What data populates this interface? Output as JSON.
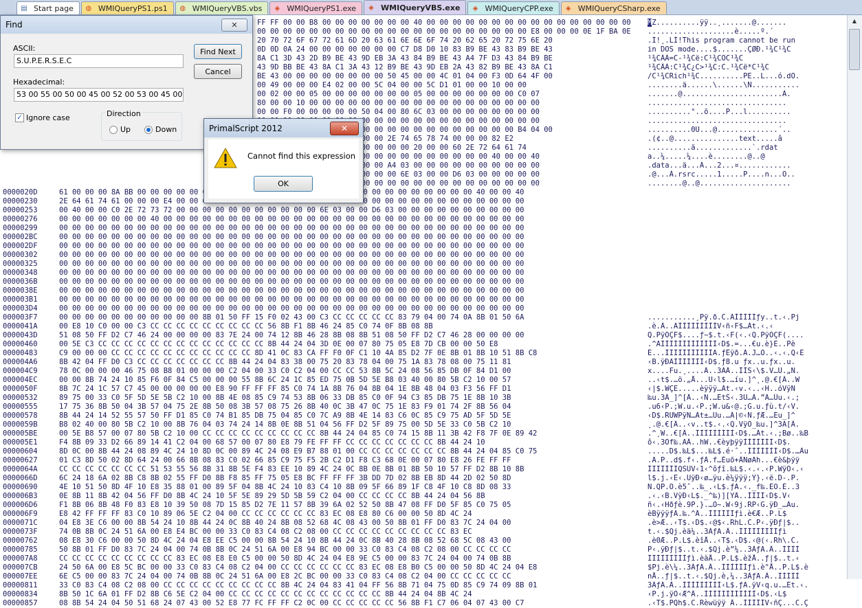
{
  "tabs": [
    {
      "label": "Start page",
      "color": "#ffffff",
      "icon": "page-icon"
    },
    {
      "label": "WMIQueryPS1.ps1",
      "color": "#f7e08a",
      "icon": "script-icon"
    },
    {
      "label": "WMIQueryVBS.vbs",
      "color": "#dff0c6",
      "icon": "script-icon"
    },
    {
      "label": "WMIQueryPS1.exe",
      "color": "#f5c6d6",
      "icon": "exe-icon"
    },
    {
      "label": "WMIQueryVBS.exe",
      "color": "#d8d2ee",
      "icon": "exe-icon",
      "active": true
    },
    {
      "label": "WMIQueryCPP.exe",
      "color": "#c9ecec",
      "icon": "exe-icon"
    },
    {
      "label": "WMIQueryCSharp.exe",
      "color": "#f8d7a6",
      "icon": "exe-icon"
    }
  ],
  "hex_rows_top": [
    {
      "bytes": "FF FF 00 00 B8 00 00 00 00 00 00 00 40 00 00 00 00 00 00 00 00 00 00 00 00 00 00 00 00 00 00 00",
      "ascii": "MZ..........ÿÿ..¸.......@......."
    },
    {
      "bytes": "00 00 00 00 00 00 00 00 00 00 00 00 00 00 00 00 00 00 00 00 00 E8 00 00 00 0E 1F BA 0E 00 B4",
      "ascii": "....................è.....º.´"
    },
    {
      "bytes": "20 70 72 6F 67 72 61 6D 20 63 61 6E 6E 6F 74 20 62 65 20 72 75 6E 20",
      "ascii": ".Í!¸.LÍ!This program cannot be run"
    },
    {
      "bytes": "0D 0D 0A 24 00 00 00 00 00 00 00 C7 D8 D0 10 83 B9 BE 43 83 B9 BE 43",
      "ascii": "in DOS mode....$.......ÇØÐ.¹¾C¹¾C"
    },
    {
      "bytes": "8A C1 3D 43 2D B9 BE 43 9D EB 3A 43 84 B9 BE 43 A4 7F D3 43 84 B9 BE",
      "ascii": "¹¾CÂÁ=C-¹¾Cë:C¹¾CÔC¹¾C"
    },
    {
      "bytes": "43 9D BB BE 43 8A C1 3A 43 12 B9 BE 43 9D EB 2A 43 82 B9 BE 43 8A C1",
      "ascii": "¹¾CÂÁ:C¹¾C¿C>¹¾C:C.¹¾Cë*C¹¾C"
    },
    {
      "bytes": "BE 43 00 00 00 00 00 00 00 00 50 45 00 00 4C 01 04 00 F3 0D 64 4F 00",
      "ascii": "/C¹¾CRich¹¾C..........PE..L...ó.dO."
    },
    {
      "bytes": "00 49 00 00 00 E4 02 00 00 5C 04 00 00 5C D1 01 00 00 10 00 00",
      "ascii": "........ä......\\......\\Ñ..........."
    },
    {
      "bytes": "00 02 00 00 05 00 00 00 00 00 00 00 05 00 00 00 00 00 00 00 C0 07",
      "ascii": ".......@.......................À."
    },
    {
      "bytes": "80 00 00 10 00 00 00 00 00 00 00 00 00 00 00 00 00 00 00 00 00 00",
      "ascii": "................................"
    },
    {
      "bytes": "00 00 F0 00 00 00 00 00 50 04 00 80 6C 03 00 00 00 00 00 00 00 00",
      "ascii": "..........°..õ....P...l.........."
    },
    {
      "bytes": "00 00 00 00 00 00 00 00 00 00 00 00 00 00 00 00 00 00 00 00 00 00",
      "ascii": "................................"
    },
    {
      "bytes": "00 00 00 00 00 00 00 00 00 00 00 00 00 00 00 00 00 00 00 00 B4 04 00",
      "ascii": "..........0U...@..............´.."
    },
    {
      "bytes": "00 00 00 00 00 00 00 00 00 00 2E 74 65 78 74 00 00 00 82 E2",
      "ascii": ".(¢..@...............text.....â"
    },
    {
      "bytes": "00 00 00 00 00 00 00 00 00 00 00 00 20 00 00 60 2E 72 64 61 74",
      "ascii": "..........ä.............`.rdat"
    },
    {
      "bytes": "00 00 00 00 00 00 00 00 00 00 00 00 00 00 00 00 00 00 40 00 00 40",
      "ascii": "a..¼.....¼....è........@..@"
    },
    {
      "bytes": "00 00 00 00 00 00 00 00 00 00 A4 03 00 00 00 00 00 00 00 00 00 00",
      "ascii": ".data...ä...Á...2...¤............"
    },
    {
      "bytes": "00 00 00 00 00 00 00 00 00 00 00 6E 03 00 00 D6 03 00 00 00 00 00",
      "ascii": ".@...Á.rsrc.....1.....P....n...Ö.."
    },
    {
      "bytes": "00 00 00 00 00 00 00 00 00 00 00 00 00 00 00 00 00 00 00 00 00 00",
      "ascii": "........@..@....................."
    }
  ],
  "hex_rows": [
    {
      "addr": "0000020D",
      "bytes": "61 00 00 00 8A BB 00 00 00 00 00 00 00 00 00 00 00 00 00 00 00 00 00 00 00 00 00 00 00 00 00 00 40 00 00 40",
      "ascii": ""
    },
    {
      "addr": "00000230",
      "bytes": "2E 64 61 74 61 00 00 00 E4 00 00 00 00 00 00 00 00 00 00 00 A4 03 00 00 00 00 00 00 00 00 00 00 00 00 00 00",
      "ascii": ""
    },
    {
      "addr": "00000253",
      "bytes": "00 40 00 00 C0 2E 72 73 72 00 00 00 00 00 00 00 00 00 00 00 6E 03 00 00 D6 03 00 00 00 00 00 00 00 00 00 00",
      "ascii": ""
    },
    {
      "addr": "00000276",
      "bytes": "00 00 00 00 00 00 00 40 00 00 00 00 00 00 00 00 00 00 00 00 00 00 00 00 00 00 00 00 00 00 00 00 00 00 00 00",
      "ascii": ""
    },
    {
      "addr": "00000299",
      "bytes": "00 00 00 00 00 00 00 00 00 00 00 00 00 00 00 00 00 00 00 00 00 00 00 00 00 00 00 00 00 00 00 00 00 00 00 00",
      "ascii": ""
    },
    {
      "addr": "000002BC",
      "bytes": "00 00 00 00 00 00 00 00 00 00 00 00 00 00 00 00 00 00 00 00 00 00 00 00 00 00 00 00 00 00 00 00 00 00 00 00",
      "ascii": ""
    },
    {
      "addr": "000002DF",
      "bytes": "00 00 00 00 00 00 00 00 00 00 00 00 00 00 00 00 00 00 00 00 00 00 00 00 00 00 00 00 00 00 00 00 00 00 00 00",
      "ascii": ""
    },
    {
      "addr": "00000302",
      "bytes": "00 00 00 00 00 00 00 00 00 00 00 00 00 00 00 00 00 00 00 00 00 00 00 00 00 00 00 00 00 00 00 00 00 00 00 00",
      "ascii": ""
    },
    {
      "addr": "00000325",
      "bytes": "00 00 00 00 00 00 00 00 00 00 00 00 00 00 00 00 00 00 00 00 00 00 00 00 00 00 00 00 00 00 00 00 00 00 00 00",
      "ascii": ""
    },
    {
      "addr": "00000348",
      "bytes": "00 00 00 00 00 00 00 00 00 00 00 00 00 00 00 00 00 00 00 00 00 00 00 00 00 00 00 00 00 00 00 00 00 00 00 00",
      "ascii": ""
    },
    {
      "addr": "0000036B",
      "bytes": "00 00 00 00 00 00 00 00 00 00 00 00 00 00 00 00 00 00 00 00 00 00 00 00 00 00 00 00 00 00 00 00 00 00 00 00",
      "ascii": ""
    },
    {
      "addr": "0000038E",
      "bytes": "00 00 00 00 00 00 00 00 00 00 00 00 00 00 00 00 00 00 00 00 00 00 00 00 00 00 00 00 00 00 00 00 00 00 00 00",
      "ascii": ""
    },
    {
      "addr": "000003B1",
      "bytes": "00 00 00 00 00 00 00 00 00 00 00 00 00 00 00 00 00 00 00 00 00 00 00 00 00 00 00 00 00 00 00 00 00 00 00 00",
      "ascii": ""
    },
    {
      "addr": "000003D4",
      "bytes": "00 00 00 00 00 00 00 00 00 00 00 00 00 00 00 00 00 00 00 00 00 00 00 00 00 00 00 00 00 00 00 00 00 00 00 00",
      "ascii": ""
    },
    {
      "addr": "000003F7",
      "bytes": "00 00 00 00 00 00 00 00 00 00 00 8B 01 50 FF 15 F0 02 43 00 C3 CC CC CC CC CC 83 79 04 00 74 0A 8B 01 50 6A",
      "ascii": "...........¸Pÿ.ð.C.ÃÌÌÌÌÌƒy..t.‹.Pj"
    },
    {
      "addr": "0000041A",
      "bytes": "00 E8 10 C0 00 00 C3 CC CC CC CC CC CC CC CC CC 56 8B F1 8B 46 24 85 C0 74 0F 8B 08 8B",
      "ascii": ".è.À..ÃÌÌÌÌÌÌÌÌÌV‹ñ‹F$…Àt.‹.‹"
    },
    {
      "addr": "0000043D",
      "bytes": "51 08 50 FF D2 C7 46 24 00 00 00 00 83 7E 24 00 74 12 8B 46 28 8B 08 8B 51 08 50 FF D2 C7 46 28 00 00 00 00",
      "ascii": "Q.PÿÒÇF$....ƒ~$.t.‹F(‹.‹Q.PÿÒÇF(...."
    },
    {
      "addr": "00000460",
      "bytes": "00 5E C3 CC CC CC CC CC CC CC CC CC CC CC CC CC 8B 44 24 04 3D 0E 00 07 80 75 05 E8 7D CB 00 00 50 E8",
      "ascii": ".^ÃÌÌÌÌÌÌÌÌÌÌÌÌÌ‹D$.=...€u.è}Ë..Pè"
    },
    {
      "addr": "00000483",
      "bytes": "C9 00 00 00 CC CC CC CC CC CC CC CC CC CC CC 8D 41 0C 83 CA FF F0 0F C1 10 4A 85 D2 7F 0E 8B 01 8B 10 51 8B C8",
      "ascii": "É...ÌÌÌÌÌÌÌÌÌÌÌA.ƒÊÿð.Á.J…Ò..‹.‹.Q‹È"
    },
    {
      "addr": "000004A6",
      "bytes": "8B 42 04 FF D0 C3 CC CC CC CC CC CC CC 8B 44 24 04 83 38 00 75 20 83 78 04 00 75 1A 83 78 08 00 75 11 81",
      "ascii": "‹B.ÿÐÃÌÌÌÌÌÌÌ‹D$.ƒ8.u ƒx..u.ƒx..u."
    },
    {
      "addr": "000004C9",
      "bytes": "78 0C 00 00 00 46 75 08 B8 01 00 00 00 C2 04 00 33 C0 C2 04 00 CC CC 53 8B 5C 24 08 56 85 DB 0F 84 D1 00",
      "ascii": "x....Fu.¸....Â..3ÀÂ..ÌÌS‹\\$.V…Û.„Ñ."
    },
    {
      "addr": "000004EC",
      "bytes": "00 00 8B 74 24 10 85 F6 0F 84 C5 00 00 00 55 8B 6C 24 1C 85 ED 75 0B 5D 5E B8 03 40 00 80 5B C2 10 00 57",
      "ascii": "..‹t$.…ö.„Å...U‹l$.…íu.]^¸.@.€[Â..W"
    },
    {
      "addr": "0000050F",
      "bytes": "8B 7C 24 1C 57 C7 45 00 00 00 00 00 E8 90 FF FF FF 85 C0 74 1A 8B 76 04 8B 04 1E 8B 48 04 03 F3 56 FF D1",
      "ascii": "‹|$.WÇE.....èÿÿÿ…Àt.‹v.‹..‹H..óVÿÑ"
    },
    {
      "addr": "00000532",
      "bytes": "89 75 00 33 C0 5F 5D 5E 5B C2 10 00 8B 4E 08 85 C9 74 53 8B 06 33 DB 85 C0 0F 94 C3 85 DB 75 1E 8B 10 3B",
      "ascii": "‰u.3À_]^[Â..‹N.…ÉtS‹.3Û…À.”Ã…Ûu.‹.;"
    },
    {
      "addr": "00000555",
      "bytes": "17 75 36 8B 50 04 3B 57 04 75 2E 8B 50 08 3B 57 08 75 26 8B 40 0C 3B 47 0C 75 1E 83 F9 01 74 2F 8B 56 04",
      "ascii": ".u6‹P.;W.u.‹P.;W.u&‹@.;G.u.ƒù.t/‹V."
    },
    {
      "addr": "00000578",
      "bytes": "8B 44 24 14 52 55 57 50 FF D1 85 C0 74 B1 85 DB 75 04 85 C0 7C A9 8B 4E 14 83 C6 0C 85 C9 75 AD 5F 5D 5E",
      "ascii": "‹D$.RUWPÿÑ…Àt±…Ûu.…À|©‹N.ƒÆ.…Éu­_]^"
    },
    {
      "addr": "0000059B",
      "bytes": "B8 02 40 00 80 5B C2 10 00 8B 76 04 03 74 24 14 8B 0E 8B 51 04 56 FF D2 5F 89 75 00 5D 5E 33 C0 5B C2 10",
      "ascii": "¸.@.€[Â..‹v..t$.‹.‹Q.VÿÒ_‰u.]^3À[Â."
    },
    {
      "addr": "000005BE",
      "bytes": "00 5E B8 57 00 07 80 5B C2 10 00 CC CC CC CC CC CC CC CC CC 8B 44 24 04 85 C0 74 15 8B 11 3B 42 F8 7F 0E 89 42",
      "ascii": ".^¸W..€[Â..ÌÌÌÌÌÌÌÌÌ‹D$.…Àt.‹.;Bø..‰B"
    },
    {
      "addr": "000005E1",
      "bytes": "F4 8B 09 33 D2 66 89 14 41 C2 04 00 68 57 00 07 80 E8 79 FE FF FF CC CC CC CC CC CC CC 8B 44 24 10",
      "ascii": "ô‹.3Òf‰.AÂ..hW..€èyþÿÿÌÌÌÌÌÌÌ‹D$."
    },
    {
      "addr": "00000604",
      "bytes": "8D 0C 00 8B 44 24 08 89 4C 24 10 8D 0C 00 89 4C 24 08 E9 B7 88 01 00 CC CC CC CC CC CC CC 8B 44 24 04 85 C0 75",
      "ascii": ".....D$.‰L$...‰L$.é·ˆ..ÌÌÌÌÌÌÌ‹D$.…Àu"
    },
    {
      "addr": "00000627",
      "bytes": "01 C3 8D 50 02 8D 64 24 00 66 8B 08 83 C0 02 66 85 C9 75 F5 2B C2 D1 F8 C3 68 0E 00 07 80 E8 26 FE FF FF",
      "ascii": ".Ã.P..d$.f‹.ƒÀ.f…Éuõ+ÂÑøÃh...€è&þÿÿ"
    },
    {
      "addr": "0000064A",
      "bytes": "CC CC CC CC CC CC CC 51 53 55 56 8B 31 8B 5E F4 83 EE 10 89 4C 24 0C 8B 0E 8B 01 8B 50 10 57 FF D2 8B 10 8B",
      "ascii": "ÌÌÌÌÌÌÌQSUV‹1‹^ôƒî.‰L$.‹.‹.‹P.WÿÒ‹.‹"
    },
    {
      "addr": "0000066D",
      "bytes": "6C 24 18 6A 02 8B C8 8B 02 55 FF D0 8B F8 85 FF 75 05 E8 BC FF FF FF 3B DD 7D 02 8B EB 8D 44 2D 02 50 8D",
      "ascii": "l$.j.‹È‹.UÿÐ‹ø…ÿu.è¼ÿÿÿ;Ý}.‹ë.D-.P."
    },
    {
      "addr": "00000690",
      "bytes": "4E 10 51 50 8D 4F 10 E8 35 88 01 00 89 5F 04 8B 4C 24 10 83 C4 10 8B 09 5F 66 89 1F C8 4F 10 C8 8D 08 33",
      "ascii": "N.QP.O.è5ˆ..‰_.‹L$.ƒÄ.‹._f‰.ÈO.È..3"
    },
    {
      "addr": "000006B3",
      "bytes": "0E 8B 11 8B 42 04 56 FF D0 8B 4C 24 10 5F 5E 89 29 5D 5B 59 C2 04 00 CC CC CC CC 8B 44 24 04 56 8B",
      "ascii": ".‹.‹B.VÿÐ‹L$._^‰)][YÂ..ÌÌÌÌ‹D$.V‹"
    },
    {
      "addr": "000006D6",
      "bytes": "F1 8B 06 8B 48 F0 83 E8 10 39 50 08 7D 15 85 D2 7E 11 57 8B 39 6A 02 52 50 8B 47 08 FF D0 5F 85 C0 75 05",
      "ascii": "ñ‹.‹Hðƒè.9P.}.…Ò~.W‹9j.RP‹G.ÿÐ_…Àu."
    },
    {
      "addr": "000006F9",
      "bytes": "E8 42 FF FF FF 83 C0 10 89 06 5E C2 04 00 CC CC CC CC CC CC 83 EC 08 E8 80 C6 00 00 50 8D 4C 24",
      "ascii": "èBÿÿÿƒÀ.‰.^Â..ÌÌÌÌÌÌƒì.è€Æ..P.L$"
    },
    {
      "addr": "0000071C",
      "bytes": "04 E8 3E C6 00 00 8B 54 24 10 8B 44 24 0C 8B 40 24 8B 08 52 68 4C 08 43 00 50 8B 01 FF D0 83 7C 24 04 00",
      "ascii": ".è>Æ..‹T$.‹D$.‹@$‹.RhL.C.P‹.ÿÐƒ|$.."
    },
    {
      "addr": "0000073F",
      "bytes": "74 0B 8B 0C 24 51 6A 00 E8 E4 BC 00 00 33 C0 83 C4 08 C2 08 00 CC CC CC CC CC CC CC CC CC 83 EC",
      "ascii": "t.‹.$Qj.èä¼..3ÀƒÄ.Â..ÌÌÌÌÌÌÌÌÌƒì"
    },
    {
      "addr": "00000762",
      "bytes": "08 E8 30 C6 00 00 50 8D 4C 24 04 E8 EE C5 00 00 8B 54 24 10 8B 44 24 0C 8B 40 28 8B 08 52 68 5C 08 43 00",
      "ascii": ".è0Æ..P.L$.èîÅ..‹T$.‹D$.‹@(‹.Rh\\.C."
    },
    {
      "addr": "00000785",
      "bytes": "50 8B 01 FF D0 83 7C 24 04 00 74 0B 8B 0C 24 51 6A 00 E8 94 BC 00 00 33 C0 83 C4 08 C2 08 00 CC CC CC CC",
      "ascii": "P‹.ÿÐƒ|$..t.‹.$Qj.è”¼..3ÀƒÄ.Â..ÌÌÌÌ"
    },
    {
      "addr": "000007A8",
      "bytes": "CC CC CC CC CC CC CC CC CC 83 EC 08 E8 E0 C5 00 00 50 8D 4C 24 04 E8 9E C5 00 00 83 7C 24 04 00 74 0B 8B",
      "ascii": "ÌÌÌÌÌÌÌÌÌƒì.èàÅ..P.L$.èžÅ..ƒ|$..t.‹"
    },
    {
      "addr": "000007CB",
      "bytes": "24 50 6A 00 E8 5C BC 00 00 33 C0 83 C4 08 C2 04 00 CC CC CC CC CC CC 83 EC 08 E8 B0 C5 00 00 50 8D 4C 24 04 E8",
      "ascii": "$Pj.è\\¼..3ÀƒÄ.Â..ÌÌÌÌÌÌƒì.è°Å..P.L$.è"
    },
    {
      "addr": "000007EE",
      "bytes": "6E C5 00 00 83 7C 24 04 00 74 0B 8B 0C 24 51 6A 00 E8 2C BC 00 00 33 C0 83 C4 08 C2 04 00 CC CC CC CC CC",
      "ascii": "nÅ..ƒ|$..t.‹.$Qj.è,¼..3ÀƒÄ.Â..ÌÌÌÌÌ"
    },
    {
      "addr": "00000811",
      "bytes": "33 C0 83 C4 08 C2 08 00 CC CC CC CC CC CC CC CC CC 8B 4C 24 04 83 41 04 FF 56 8B 71 04 75 0D 85 C9 74 09 8B 01",
      "ascii": "3ÀƒÄ.Â..ÌÌÌÌÌÌÌÌÌ‹L$.ƒA.ÿV‹q.u.…Ét.‹."
    },
    {
      "addr": "00000834",
      "bytes": "8B 50 1C 6A 01 FF D2 8B C6 5E C2 04 00 CC CC CC CC CC CC CC CC CC CC CC CC 8B 44 24 04 8B 4C 24",
      "ascii": "‹P.j.ÿÒ‹Æ^Â..ÌÌÌÌÌÌÌÌÌÌÌÌ‹D$.‹L$"
    },
    {
      "addr": "00000857",
      "bytes": "08 8B 54 24 04 50 51 68 24 07 43 00 52 E8 77 FC FF FF C2 0C 00 CC CC CC CC CC 56 8B F1 C7 06 04 07 43 00 C7",
      "ascii": ".‹T$.PQh$.C.Rèwüÿÿ Â..ÌÌÌÌÌV‹ñÇ...C.Ç"
    }
  ],
  "find_dialog": {
    "title": "Find",
    "ascii_label": "ASCII:",
    "ascii_value": "S.U.P.E.R.S.E.C",
    "hex_label": "Hexadecimal:",
    "hex_value": "53 00 55 00 50 00 45 00 52 00 53 00 45 00 43",
    "find_next_label": "Find Next",
    "cancel_label": "Cancel",
    "ignore_case_label": "Ignore case",
    "direction_label": "Direction",
    "up_label": "Up",
    "down_label": "Down",
    "close_label": "✕"
  },
  "message_box": {
    "title": "PrimalScript 2012",
    "message": "Cannot find this expression",
    "ok_label": "OK",
    "close_label": "✕"
  }
}
